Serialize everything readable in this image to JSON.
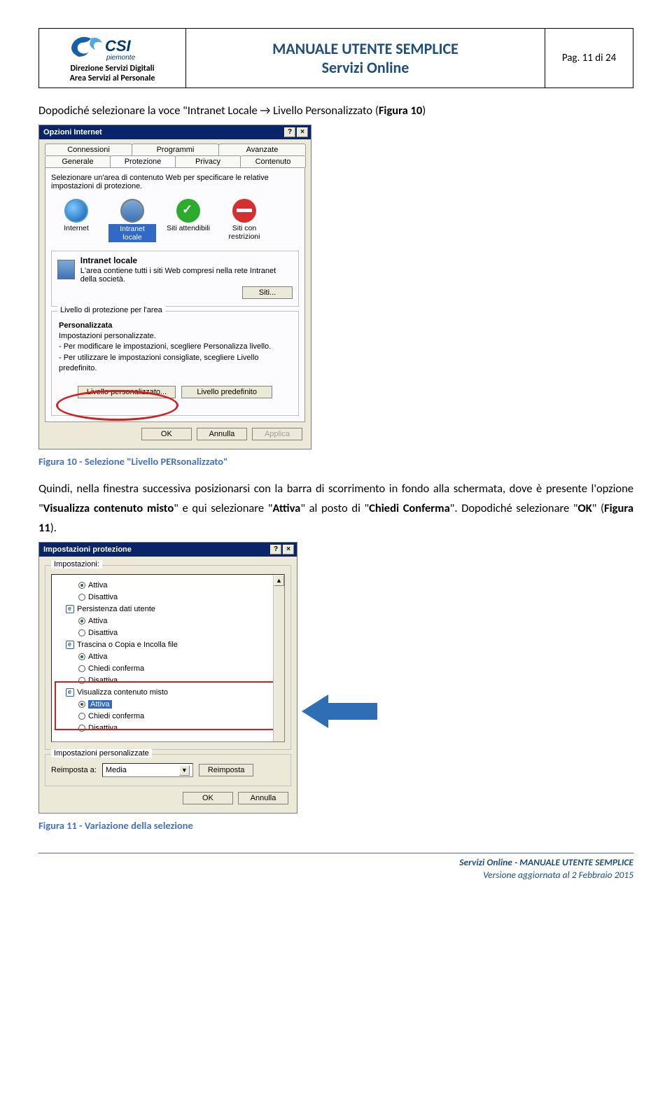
{
  "header": {
    "org_sub1": "Direzione Servizi Digitali",
    "org_sub2": "Area Servizi al Personale",
    "title1": "MANUALE UTENTE SEMPLICE",
    "title2": "Servizi Online",
    "page_ind": "Pag. 11 di 24",
    "logo_text_main": "CSI",
    "logo_text_sub": "piemonte"
  },
  "para1_pre": "Dopodiché selezionare la voce \"Intranet Locale ",
  "para1_post": " Livello Personalizzato (",
  "para1_fig": "Figura 10",
  "para1_close": ")",
  "dialog1": {
    "title": "Opzioni Internet",
    "help": "?",
    "close": "×",
    "tabs_row1": [
      "Connessioni",
      "Programmi",
      "Avanzate"
    ],
    "tabs_row2": [
      "Generale",
      "Protezione",
      "Privacy",
      "Contenuto"
    ],
    "instr": "Selezionare un'area di contenuto Web per specificare le relative impostazioni di protezione.",
    "zones": {
      "internet": "Internet",
      "intranet": "Intranet locale",
      "trusted": "Siti attendibili",
      "restricted": "Siti con restrizioni"
    },
    "zone_group": {
      "title": "Intranet locale",
      "desc": "L'area contiene tutti i siti Web compresi nella rete Intranet della società.",
      "siti_btn": "Siti..."
    },
    "level_group_legend": "Livello di protezione per l'area",
    "pers_title": "Personalizzata",
    "pers_lines": [
      "Impostazioni personalizzate.",
      "- Per modificare le impostazioni, scegliere Personalizza livello.",
      "- Per utilizzare le impostazioni consigliate, scegliere Livello predefinito."
    ],
    "btn_custom": "Livello personalizzato...",
    "btn_default": "Livello predefinito",
    "btn_ok": "OK",
    "btn_cancel": "Annulla",
    "btn_apply": "Applica"
  },
  "caption1": "Figura 10 - Selezione \"Livello PERsonalizzato\"",
  "para2_a": "Quindi, nella finestra successiva posizionarsi con la barra di scorrimento in fondo alla schermata, dove è presente l'opzione \"",
  "para2_b": "Visualizza contenuto misto",
  "para2_c": "\" e qui selezionare \"",
  "para2_d": "Attiva",
  "para2_e": "\" al posto di \"",
  "para2_f": "Chiedi Conferma",
  "para2_g": "\". Dopodiché selezionare \"",
  "para2_h": "OK",
  "para2_i": "\" (",
  "para2_fig": "Figura 11",
  "para2_j": ").",
  "dialog2": {
    "title": "Impostazioni protezione",
    "label_imp": "Impostazioni:",
    "items": {
      "attiva": "Attiva",
      "disattiva": "Disattiva",
      "persist": "Persistenza dati utente",
      "trascina": "Trascina o Copia e Incolla file",
      "chiedi": "Chiedi conferma",
      "visual": "Visualizza contenuto misto"
    },
    "group_legend": "Impostazioni personalizzate",
    "reimposta_lbl": "Reimposta a:",
    "reimposta_val": "Media",
    "reimposta_btn": "Reimposta",
    "btn_ok": "OK",
    "btn_cancel": "Annulla"
  },
  "caption2": "Figura 11 - Variazione della selezione",
  "footer": {
    "line1a": "Servizi Online",
    "line1b": "  -  MANUALE UTENTE SEMPLICE",
    "line2": "Versione aggiornata al 2 Febbraio 2015"
  }
}
